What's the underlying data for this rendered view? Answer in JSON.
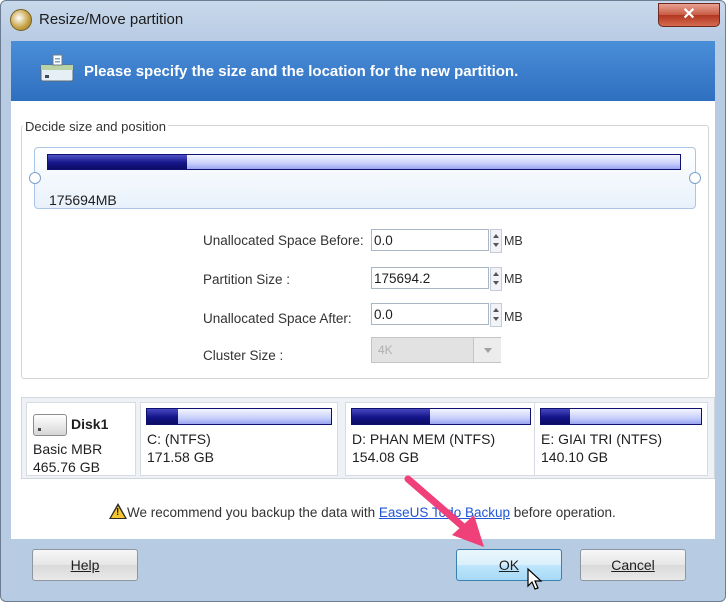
{
  "window": {
    "title": "Resize/Move partition",
    "close_glyph": "✕"
  },
  "banner": {
    "text": "Please specify the size and the location for the new partition.",
    "icon": "partition-disk-icon"
  },
  "group": {
    "title": "Decide size and position",
    "partition_size_display": "175694MB",
    "used_fraction": 0.22
  },
  "fields": {
    "before": {
      "label": "Unallocated Space Before:",
      "value": "0.0",
      "unit": "MB"
    },
    "size": {
      "label": "Partition Size :",
      "value": "175694.2",
      "unit": "MB"
    },
    "after": {
      "label": "Unallocated Space After:",
      "value": "0.0",
      "unit": "MB"
    },
    "cluster": {
      "label": "Cluster Size :",
      "value": "4K"
    }
  },
  "disk": {
    "name": "Disk1",
    "type": "Basic MBR",
    "size": "465.76 GB",
    "partitions": [
      {
        "name": "C: (NTFS)",
        "size": "171.58 GB",
        "used_fraction": 0.17
      },
      {
        "name": "D: PHAN MEM  (NTFS)",
        "size": "154.08 GB",
        "used_fraction": 0.44
      },
      {
        "name": "E: GIAI TRI (NTFS)",
        "size": "140.10 GB",
        "used_fraction": 0.18
      }
    ]
  },
  "warning": {
    "prefix": "We recommend you backup the data with ",
    "link": "EaseUS Todo Backup",
    "suffix": " before operation."
  },
  "buttons": {
    "help": "Help",
    "ok": "OK",
    "cancel": "Cancel"
  },
  "colors": {
    "banner": "#3a7fcf",
    "bar_fill": "#16168a",
    "annotation_arrow": "#f0407a"
  }
}
